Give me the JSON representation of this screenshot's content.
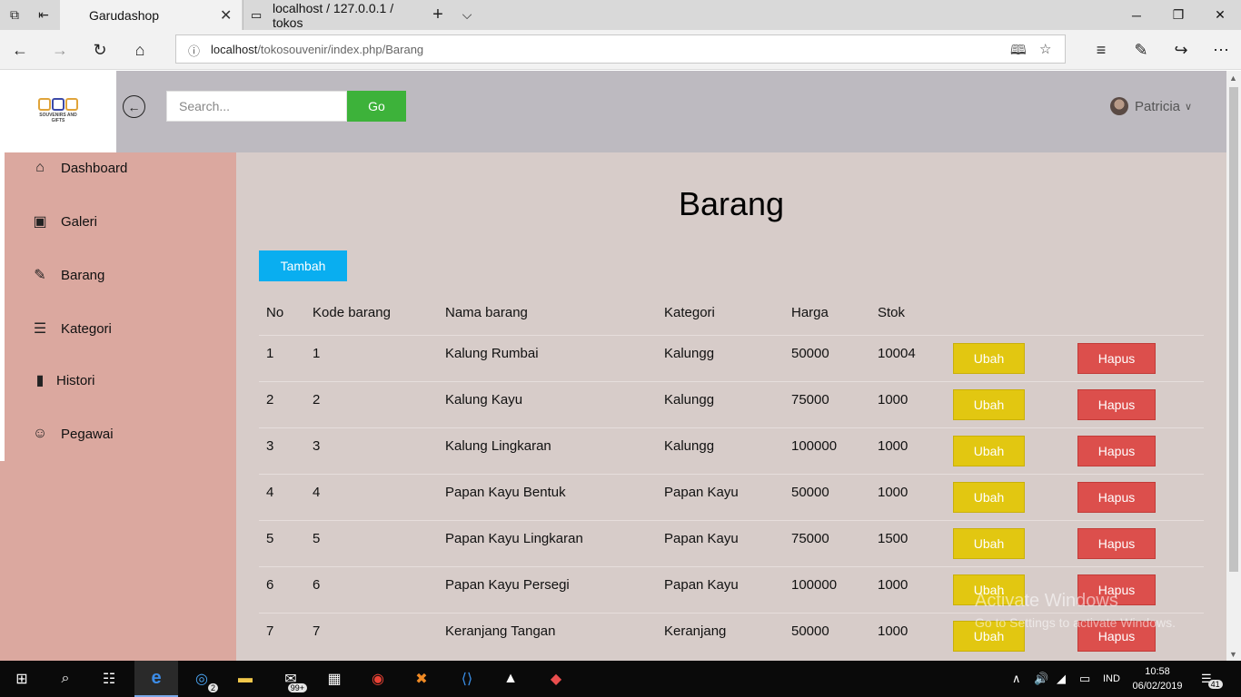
{
  "browser": {
    "tabs": [
      {
        "title": "Garudashop",
        "active": true
      },
      {
        "title": "localhost / 127.0.0.1 / tokos",
        "active": false
      }
    ],
    "url_host": "localhost",
    "url_path": "/tokosouvenir/index.php/Barang"
  },
  "header": {
    "logo_text": "SOUVENIRS AND GIFTS",
    "search_placeholder": "Search...",
    "go_label": "Go",
    "user_name": "Patricia"
  },
  "sidebar": {
    "items": [
      {
        "label": "Dashboard",
        "icon": "home-icon"
      },
      {
        "label": "Galeri",
        "icon": "image-icon"
      },
      {
        "label": "Barang",
        "icon": "pencil-icon"
      },
      {
        "label": "Kategori",
        "icon": "list-icon"
      },
      {
        "label": "Histori",
        "icon": "bookmark-icon"
      },
      {
        "label": "Pegawai",
        "icon": "user-icon"
      }
    ]
  },
  "main": {
    "title": "Barang",
    "add_label": "Tambah",
    "columns": [
      "No",
      "Kode barang",
      "Nama barang",
      "Kategori",
      "Harga",
      "Stok"
    ],
    "edit_label": "Ubah",
    "delete_label": "Hapus",
    "rows": [
      {
        "no": "1",
        "kode": "1",
        "nama": "Kalung Rumbai",
        "kategori": "Kalungg",
        "harga": "50000",
        "stok": "10004"
      },
      {
        "no": "2",
        "kode": "2",
        "nama": "Kalung Kayu",
        "kategori": "Kalungg",
        "harga": "75000",
        "stok": "1000"
      },
      {
        "no": "3",
        "kode": "3",
        "nama": "Kalung Lingkaran",
        "kategori": "Kalungg",
        "harga": "100000",
        "stok": "1000"
      },
      {
        "no": "4",
        "kode": "4",
        "nama": "Papan Kayu Bentuk",
        "kategori": "Papan Kayu",
        "harga": "50000",
        "stok": "1000"
      },
      {
        "no": "5",
        "kode": "5",
        "nama": "Papan Kayu Lingkaran",
        "kategori": "Papan Kayu",
        "harga": "75000",
        "stok": "1500"
      },
      {
        "no": "6",
        "kode": "6",
        "nama": "Papan Kayu Persegi",
        "kategori": "Papan Kayu",
        "harga": "100000",
        "stok": "1000"
      },
      {
        "no": "7",
        "kode": "7",
        "nama": "Keranjang Tangan",
        "kategori": "Keranjang",
        "harga": "50000",
        "stok": "1000"
      }
    ]
  },
  "watermark": {
    "line1": "Activate Windows",
    "line2": "Go to Settings to activate Windows."
  },
  "taskbar": {
    "instagram_badge": "2",
    "mail_badge": "99+",
    "language": "IND",
    "time": "10:58",
    "date": "06/02/2019",
    "notification_count": "41"
  },
  "colors": {
    "header_bg": "#bdbac0",
    "sidebar_bg": "#dba89f",
    "content_bg": "#d7ccc9",
    "go_button": "#3db23a",
    "add_button": "#09aef0",
    "edit_button": "#e2c711",
    "delete_button": "#dc4f4c"
  }
}
